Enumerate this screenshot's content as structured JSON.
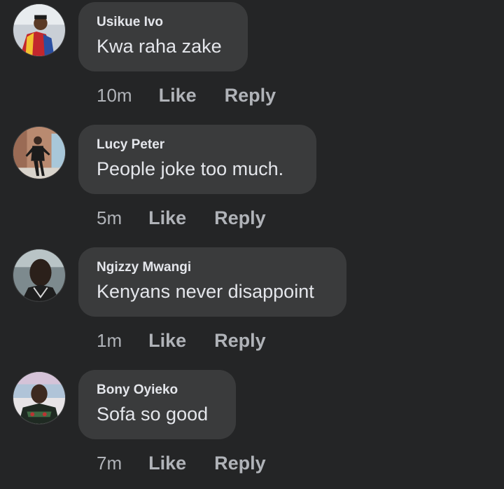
{
  "comments": [
    {
      "author": "Usikue Ivo",
      "text": "Kwa raha zake",
      "time": "10m",
      "like_label": "Like",
      "reply_label": "Reply",
      "avatar_icon": "profile-photo"
    },
    {
      "author": "Lucy Peter",
      "text": "People joke too much.",
      "time": "5m",
      "like_label": "Like",
      "reply_label": "Reply",
      "avatar_icon": "profile-photo"
    },
    {
      "author": "Ngizzy Mwangi",
      "text": "Kenyans never disappoint",
      "time": "1m",
      "like_label": "Like",
      "reply_label": "Reply",
      "avatar_icon": "profile-photo"
    },
    {
      "author": "Bony Oyieko",
      "text": "Sofa so good",
      "time": "7m",
      "like_label": "Like",
      "reply_label": "Reply",
      "avatar_icon": "profile-photo"
    }
  ],
  "colors": {
    "background": "#242526",
    "bubble": "#3a3b3c",
    "primary_text": "#e4e6eb",
    "secondary_text": "#b0b3b8"
  }
}
